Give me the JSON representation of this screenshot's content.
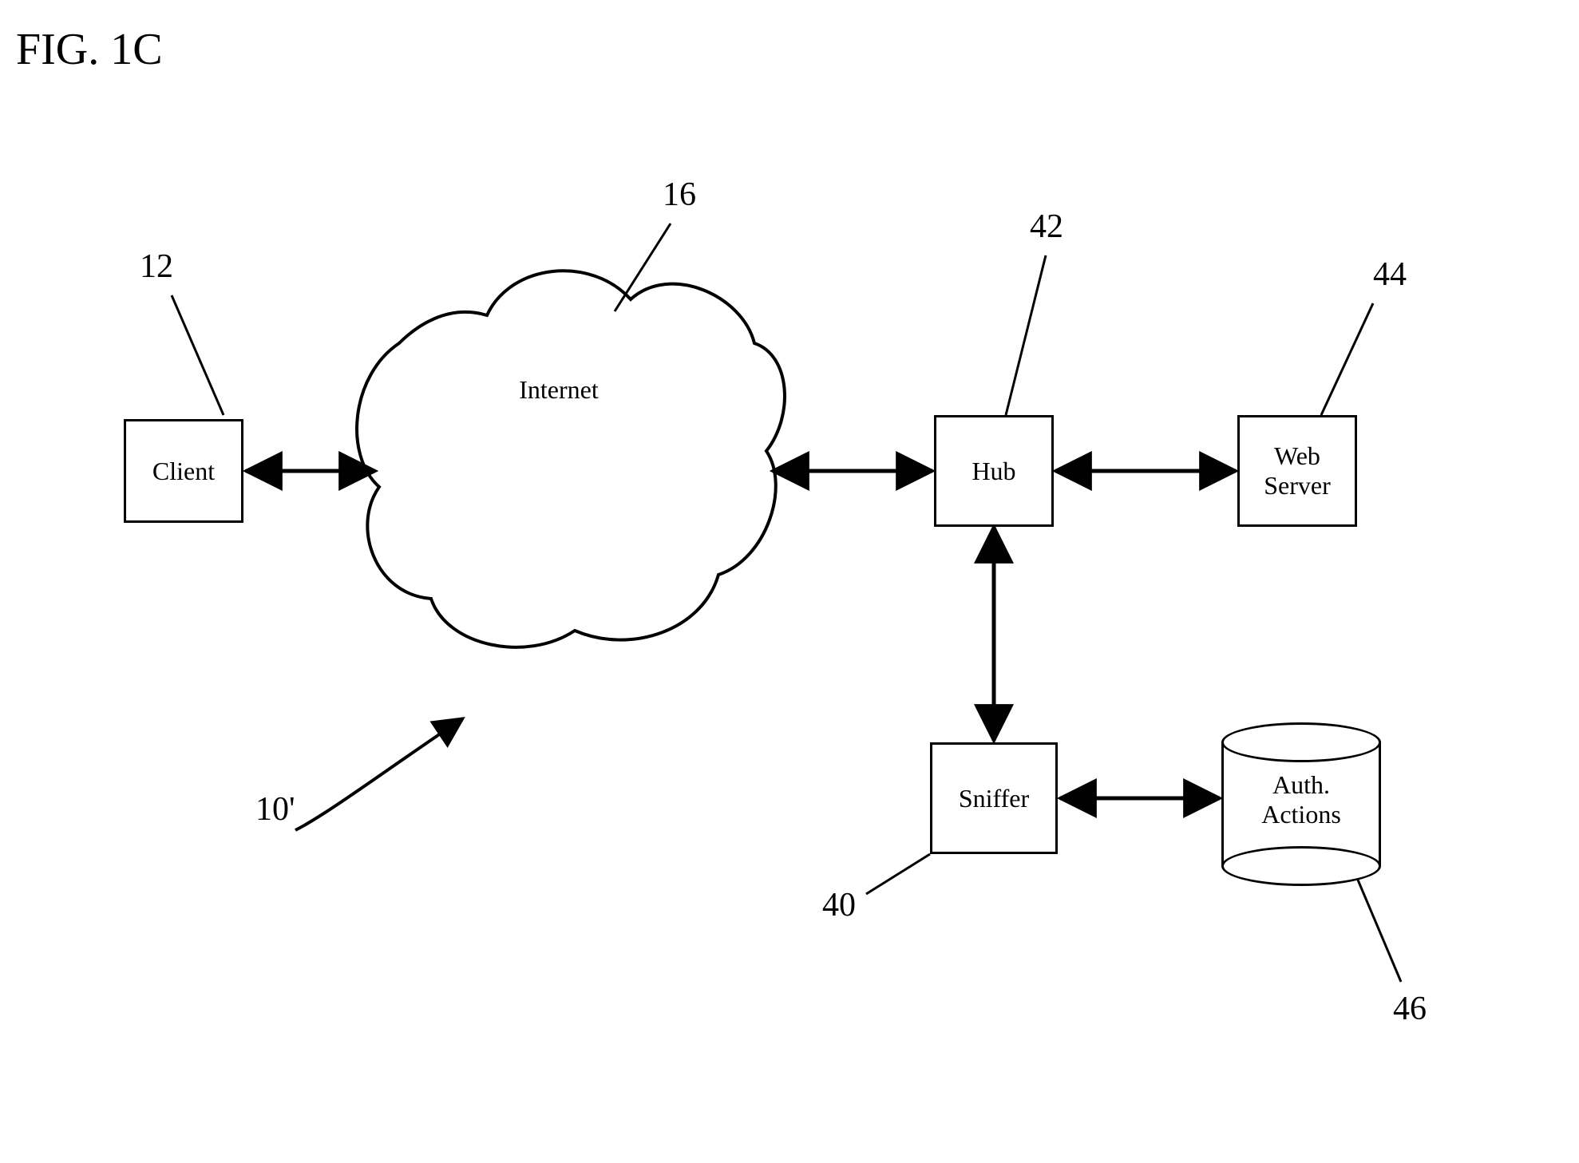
{
  "figure": {
    "title": "FIG. 1C"
  },
  "refs": {
    "client": "12",
    "internet": "16",
    "hub": "42",
    "webserver": "44",
    "sniffer": "40",
    "auth": "46",
    "system": "10'"
  },
  "nodes": {
    "client": "Client",
    "internet": "Internet",
    "hub": "Hub",
    "webserver": "Web\nServer",
    "sniffer": "Sniffer",
    "auth_line1": "Auth.",
    "auth_line2": "Actions"
  }
}
